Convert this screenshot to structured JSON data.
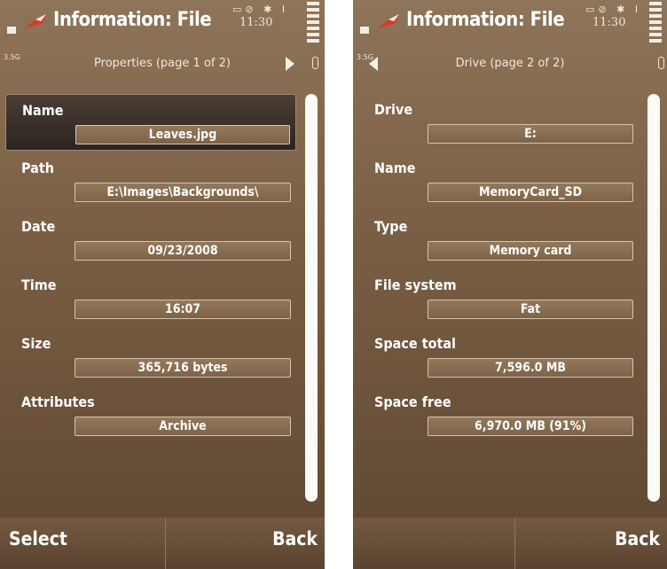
{
  "screens": [
    {
      "status": {
        "title": "Information: File",
        "clock": "11:30",
        "indicators": "▭⊘ ✱ I",
        "small": "3.5G"
      },
      "nav": {
        "title": "Properties (page 1 of 2)"
      },
      "fields": [
        {
          "label": "Name",
          "value": "Leaves.jpg"
        },
        {
          "label": "Path",
          "value": "E:\\Images\\Backgrounds\\"
        },
        {
          "label": "Date",
          "value": "09/23/2008"
        },
        {
          "label": "Time",
          "value": "16:07"
        },
        {
          "label": "Size",
          "value": "365,716 bytes"
        },
        {
          "label": "Attributes",
          "value": "Archive"
        }
      ],
      "softkeys": {
        "left": "Select",
        "right": "Back"
      }
    },
    {
      "status": {
        "title": "Information: File",
        "clock": "11:30",
        "indicators": "▭⊘ ✱ I",
        "small": "3.5G"
      },
      "nav": {
        "title": "Drive (page 2 of 2)"
      },
      "fields": [
        {
          "label": "Drive",
          "value": "E:"
        },
        {
          "label": "Name",
          "value": "MemoryCard_SD"
        },
        {
          "label": "Type",
          "value": "Memory card"
        },
        {
          "label": "File system",
          "value": "Fat"
        },
        {
          "label": "Space total",
          "value": "7,596.0 MB"
        },
        {
          "label": "Space free",
          "value": "6,970.0 MB (91%)"
        }
      ],
      "softkeys": {
        "left": "",
        "right": "Back"
      }
    }
  ]
}
